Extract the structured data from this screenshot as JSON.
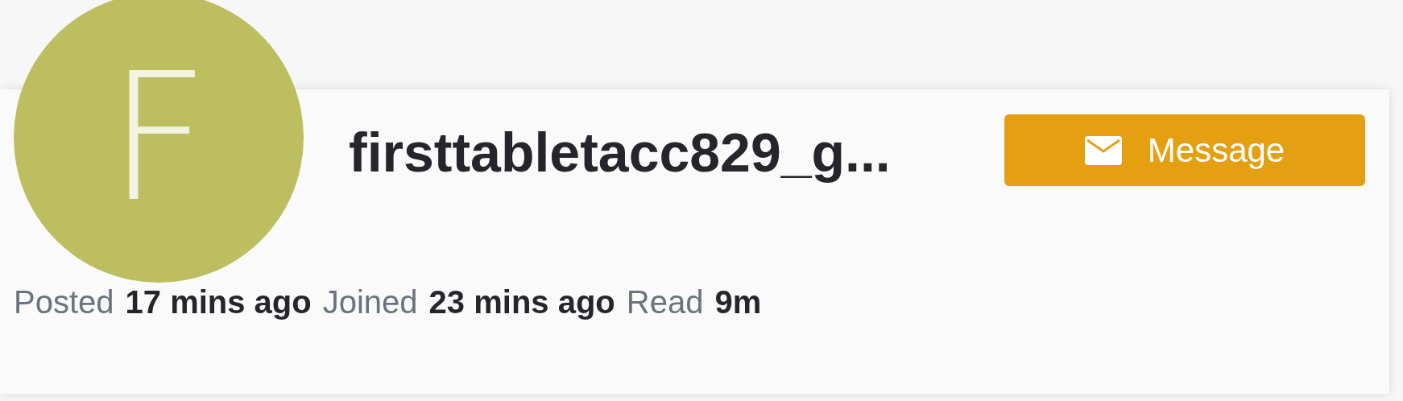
{
  "avatar": {
    "initial": "F"
  },
  "username": "firsttabletacc829_g...",
  "message_button": {
    "label": "Message"
  },
  "stats": [
    {
      "label": "Posted",
      "value": "17 mins ago"
    },
    {
      "label": "Joined",
      "value": "23 mins ago"
    },
    {
      "label": "Read",
      "value": "9m"
    }
  ]
}
